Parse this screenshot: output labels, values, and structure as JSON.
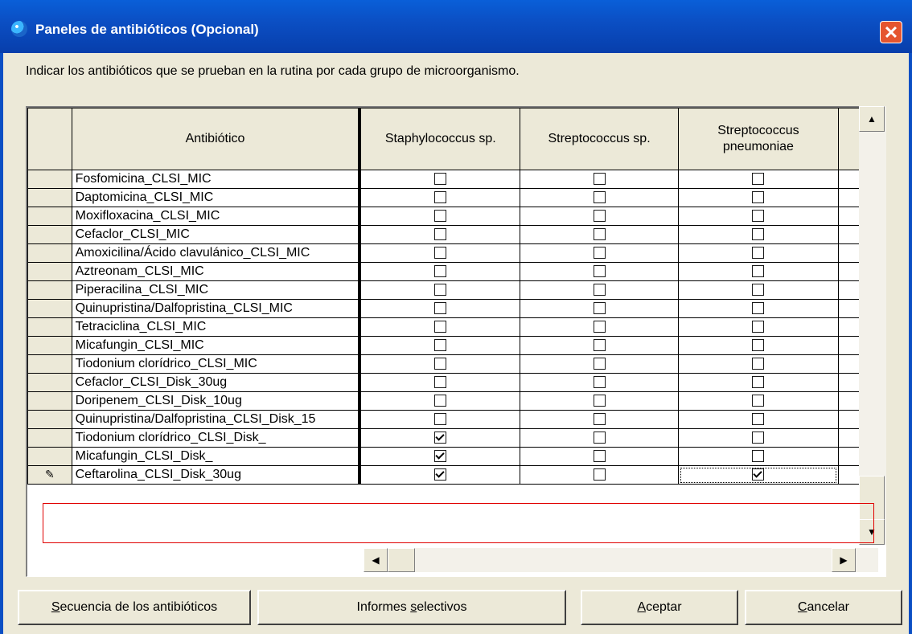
{
  "window": {
    "title": "Paneles de antibióticos (Opcional)",
    "close_label": "✕"
  },
  "instruction": "Indicar los antibióticos que se prueban en la rutina por cada grupo de microorganismo.",
  "table": {
    "headers": [
      "Antibiótico",
      "Staphylococcus sp.",
      "Streptococcus sp.",
      "Streptococcus pneumoniae"
    ],
    "header3_line1": "Streptococcus",
    "header3_line2": "pneumoniae",
    "rows": [
      {
        "name": "Fosfomicina_CLSI_MIC",
        "checks": [
          false,
          false,
          false
        ]
      },
      {
        "name": "Daptomicina_CLSI_MIC",
        "checks": [
          false,
          false,
          false
        ]
      },
      {
        "name": "Moxifloxacina_CLSI_MIC",
        "checks": [
          false,
          false,
          false
        ]
      },
      {
        "name": "Cefaclor_CLSI_MIC",
        "checks": [
          false,
          false,
          false
        ]
      },
      {
        "name": "Amoxicilina/Ácido clavulánico_CLSI_MIC",
        "checks": [
          false,
          false,
          false
        ]
      },
      {
        "name": "Aztreonam_CLSI_MIC",
        "checks": [
          false,
          false,
          false
        ]
      },
      {
        "name": "Piperacilina_CLSI_MIC",
        "checks": [
          false,
          false,
          false
        ]
      },
      {
        "name": "Quinupristina/Dalfopristina_CLSI_MIC",
        "checks": [
          false,
          false,
          false
        ]
      },
      {
        "name": "Tetraciclina_CLSI_MIC",
        "checks": [
          false,
          false,
          false
        ]
      },
      {
        "name": "Micafungin_CLSI_MIC",
        "checks": [
          false,
          false,
          false
        ]
      },
      {
        "name": "Tiodonium clorídrico_CLSI_MIC",
        "checks": [
          false,
          false,
          false
        ]
      },
      {
        "name": "Cefaclor_CLSI_Disk_30ug",
        "checks": [
          false,
          false,
          false
        ]
      },
      {
        "name": "Doripenem_CLSI_Disk_10ug",
        "checks": [
          false,
          false,
          false
        ]
      },
      {
        "name": "Quinupristina/Dalfopristina_CLSI_Disk_15",
        "checks": [
          false,
          false,
          false
        ]
      },
      {
        "name": "Tiodonium clorídrico_CLSI_Disk_",
        "checks": [
          true,
          false,
          false
        ]
      },
      {
        "name": "Micafungin_CLSI_Disk_",
        "checks": [
          true,
          false,
          false
        ]
      },
      {
        "name": "Ceftarolina_CLSI_Disk_30ug",
        "checks": [
          true,
          false,
          true
        ],
        "editing": true
      }
    ]
  },
  "buttons": {
    "sequence": "Secuencia de los antibióticos",
    "reports": "Informes selectivos",
    "accept": "Aceptar",
    "cancel": "Cancelar"
  },
  "icons": {
    "edit_row": "pencil-icon",
    "app": "globe-icon"
  }
}
